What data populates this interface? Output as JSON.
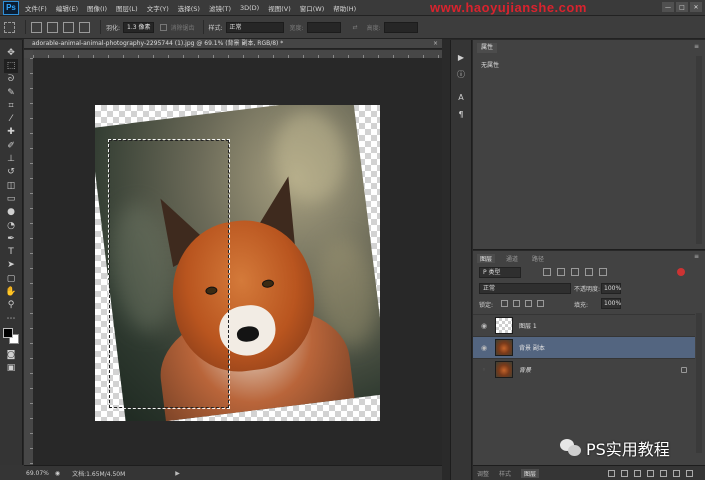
{
  "app": {
    "logo": "Ps",
    "menu": [
      "文件(F)",
      "编辑(E)",
      "图像(I)",
      "图层(L)",
      "文字(Y)",
      "选择(S)",
      "滤镜(T)",
      "3D(D)",
      "视图(V)",
      "窗口(W)",
      "帮助(H)"
    ],
    "watermark_url": "www.haoyujianshe.com",
    "window_buttons": [
      "—",
      "□",
      "✕"
    ]
  },
  "options": {
    "feather_label": "羽化:",
    "feather_value": "1.3 像素",
    "antialias_label": "消除锯齿",
    "style_label": "样式:",
    "style_value": "正常",
    "width_label": "宽度:",
    "height_label": "高度:"
  },
  "document": {
    "tab_title": "adorable-animal-animal-photography-2295744 (1).jpg @ 69.1% (背景 副本, RGB/8) *",
    "close": "×"
  },
  "status": {
    "zoom": "69.07%",
    "doc_info": "文档:1.65M/4.50M",
    "arrow": "▶"
  },
  "properties": {
    "tab": "属性",
    "value": "无属性",
    "menu": "≡"
  },
  "layers": {
    "tabs": [
      "图层",
      "通道",
      "路径"
    ],
    "menu": "≡",
    "filter_kind": "P 类型",
    "blend_mode": "正常",
    "opacity_label": "不透明度:",
    "opacity_value": "100%",
    "lock_label": "锁定:",
    "fill_label": "填充:",
    "fill_value": "100%",
    "rows": [
      {
        "name": "图层 1",
        "thumb": "transparent"
      },
      {
        "name": "背景 副本",
        "thumb": "fox"
      },
      {
        "name": "背景",
        "thumb": "fox"
      }
    ]
  },
  "bottom_tabs": [
    "调整",
    "样式",
    "图层"
  ],
  "brand": {
    "text": "PS实用教程"
  },
  "colors": {
    "foreground": "#000000",
    "background": "#ffffff",
    "selected_layer": "#536580",
    "watermark_url": "#d9232e"
  }
}
